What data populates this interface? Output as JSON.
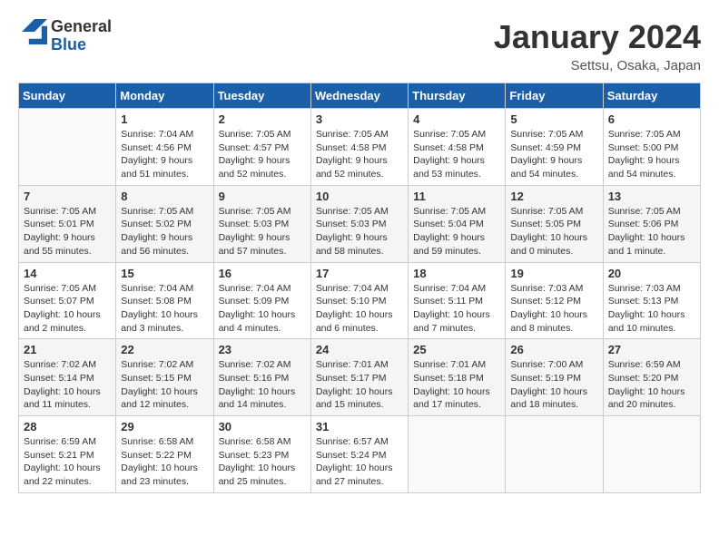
{
  "header": {
    "logo_general": "General",
    "logo_blue": "Blue",
    "month_title": "January 2024",
    "location": "Settsu, Osaka, Japan"
  },
  "days_of_week": [
    "Sunday",
    "Monday",
    "Tuesday",
    "Wednesday",
    "Thursday",
    "Friday",
    "Saturday"
  ],
  "weeks": [
    [
      {
        "day": "",
        "info": ""
      },
      {
        "day": "1",
        "info": "Sunrise: 7:04 AM\nSunset: 4:56 PM\nDaylight: 9 hours\nand 51 minutes."
      },
      {
        "day": "2",
        "info": "Sunrise: 7:05 AM\nSunset: 4:57 PM\nDaylight: 9 hours\nand 52 minutes."
      },
      {
        "day": "3",
        "info": "Sunrise: 7:05 AM\nSunset: 4:58 PM\nDaylight: 9 hours\nand 52 minutes."
      },
      {
        "day": "4",
        "info": "Sunrise: 7:05 AM\nSunset: 4:58 PM\nDaylight: 9 hours\nand 53 minutes."
      },
      {
        "day": "5",
        "info": "Sunrise: 7:05 AM\nSunset: 4:59 PM\nDaylight: 9 hours\nand 54 minutes."
      },
      {
        "day": "6",
        "info": "Sunrise: 7:05 AM\nSunset: 5:00 PM\nDaylight: 9 hours\nand 54 minutes."
      }
    ],
    [
      {
        "day": "7",
        "info": "Sunrise: 7:05 AM\nSunset: 5:01 PM\nDaylight: 9 hours\nand 55 minutes."
      },
      {
        "day": "8",
        "info": "Sunrise: 7:05 AM\nSunset: 5:02 PM\nDaylight: 9 hours\nand 56 minutes."
      },
      {
        "day": "9",
        "info": "Sunrise: 7:05 AM\nSunset: 5:03 PM\nDaylight: 9 hours\nand 57 minutes."
      },
      {
        "day": "10",
        "info": "Sunrise: 7:05 AM\nSunset: 5:03 PM\nDaylight: 9 hours\nand 58 minutes."
      },
      {
        "day": "11",
        "info": "Sunrise: 7:05 AM\nSunset: 5:04 PM\nDaylight: 9 hours\nand 59 minutes."
      },
      {
        "day": "12",
        "info": "Sunrise: 7:05 AM\nSunset: 5:05 PM\nDaylight: 10 hours\nand 0 minutes."
      },
      {
        "day": "13",
        "info": "Sunrise: 7:05 AM\nSunset: 5:06 PM\nDaylight: 10 hours\nand 1 minute."
      }
    ],
    [
      {
        "day": "14",
        "info": "Sunrise: 7:05 AM\nSunset: 5:07 PM\nDaylight: 10 hours\nand 2 minutes."
      },
      {
        "day": "15",
        "info": "Sunrise: 7:04 AM\nSunset: 5:08 PM\nDaylight: 10 hours\nand 3 minutes."
      },
      {
        "day": "16",
        "info": "Sunrise: 7:04 AM\nSunset: 5:09 PM\nDaylight: 10 hours\nand 4 minutes."
      },
      {
        "day": "17",
        "info": "Sunrise: 7:04 AM\nSunset: 5:10 PM\nDaylight: 10 hours\nand 6 minutes."
      },
      {
        "day": "18",
        "info": "Sunrise: 7:04 AM\nSunset: 5:11 PM\nDaylight: 10 hours\nand 7 minutes."
      },
      {
        "day": "19",
        "info": "Sunrise: 7:03 AM\nSunset: 5:12 PM\nDaylight: 10 hours\nand 8 minutes."
      },
      {
        "day": "20",
        "info": "Sunrise: 7:03 AM\nSunset: 5:13 PM\nDaylight: 10 hours\nand 10 minutes."
      }
    ],
    [
      {
        "day": "21",
        "info": "Sunrise: 7:02 AM\nSunset: 5:14 PM\nDaylight: 10 hours\nand 11 minutes."
      },
      {
        "day": "22",
        "info": "Sunrise: 7:02 AM\nSunset: 5:15 PM\nDaylight: 10 hours\nand 12 minutes."
      },
      {
        "day": "23",
        "info": "Sunrise: 7:02 AM\nSunset: 5:16 PM\nDaylight: 10 hours\nand 14 minutes."
      },
      {
        "day": "24",
        "info": "Sunrise: 7:01 AM\nSunset: 5:17 PM\nDaylight: 10 hours\nand 15 minutes."
      },
      {
        "day": "25",
        "info": "Sunrise: 7:01 AM\nSunset: 5:18 PM\nDaylight: 10 hours\nand 17 minutes."
      },
      {
        "day": "26",
        "info": "Sunrise: 7:00 AM\nSunset: 5:19 PM\nDaylight: 10 hours\nand 18 minutes."
      },
      {
        "day": "27",
        "info": "Sunrise: 6:59 AM\nSunset: 5:20 PM\nDaylight: 10 hours\nand 20 minutes."
      }
    ],
    [
      {
        "day": "28",
        "info": "Sunrise: 6:59 AM\nSunset: 5:21 PM\nDaylight: 10 hours\nand 22 minutes."
      },
      {
        "day": "29",
        "info": "Sunrise: 6:58 AM\nSunset: 5:22 PM\nDaylight: 10 hours\nand 23 minutes."
      },
      {
        "day": "30",
        "info": "Sunrise: 6:58 AM\nSunset: 5:23 PM\nDaylight: 10 hours\nand 25 minutes."
      },
      {
        "day": "31",
        "info": "Sunrise: 6:57 AM\nSunset: 5:24 PM\nDaylight: 10 hours\nand 27 minutes."
      },
      {
        "day": "",
        "info": ""
      },
      {
        "day": "",
        "info": ""
      },
      {
        "day": "",
        "info": ""
      }
    ]
  ]
}
